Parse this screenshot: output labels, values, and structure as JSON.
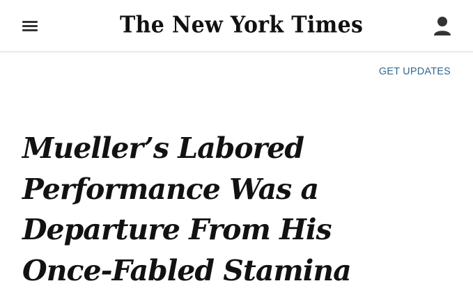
{
  "header": {
    "masthead": "The New York Times",
    "menu_icon": "hamburger-menu-icon",
    "account_icon": "user-account-icon"
  },
  "actions": {
    "get_updates_label": "GET UPDATES"
  },
  "article": {
    "headline_lines": [
      "Mueller’s Labored",
      "Performance Was a",
      "Departure From His",
      "Once-Fabled Stamina"
    ]
  },
  "colors": {
    "link": "#326891",
    "text": "#121212",
    "divider": "#d9d9d9"
  }
}
